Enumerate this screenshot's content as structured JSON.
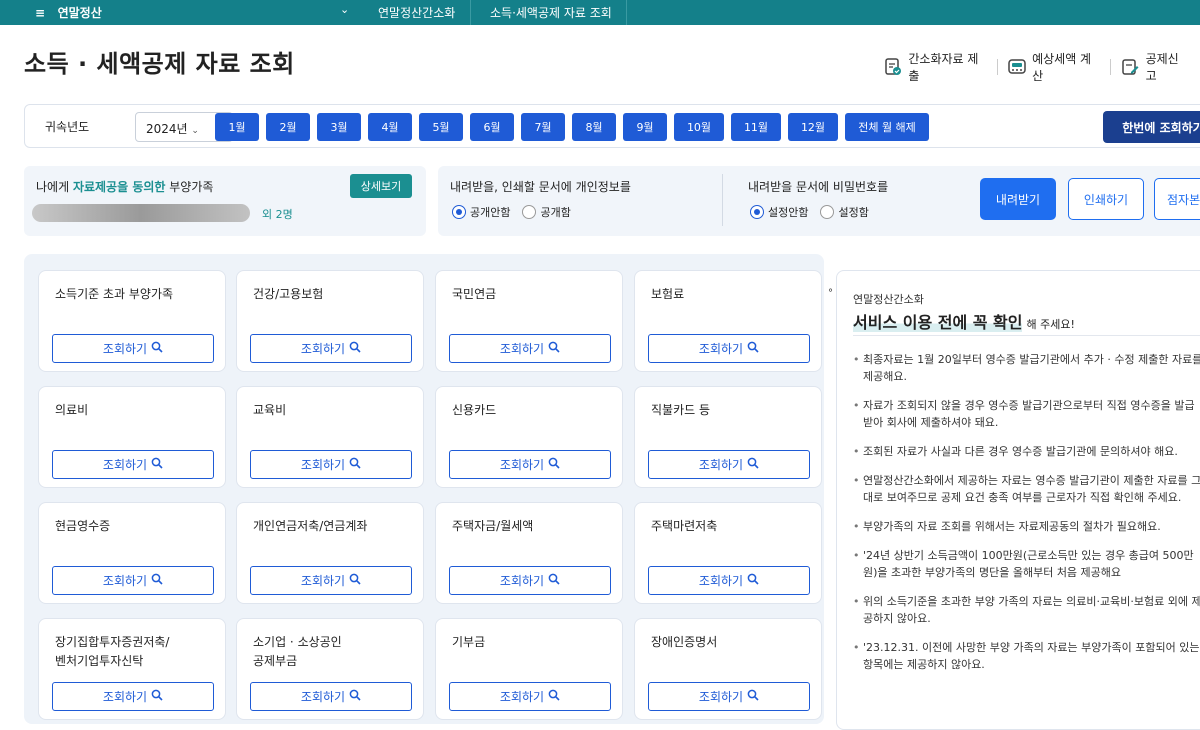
{
  "topbar": {
    "menu_label": "연말정산",
    "breadcrumb": [
      "연말정산간소화",
      "소득·세액공제 자료 조회"
    ]
  },
  "page_title": "소득 · 세액공제 자료 조회",
  "actions": [
    {
      "label": "간소화자료 제출",
      "icon": "document-submit-icon"
    },
    {
      "label": "예상세액 계산",
      "icon": "calculator-icon"
    },
    {
      "label": "공제신고",
      "icon": "form-edit-icon"
    }
  ],
  "year_filter": {
    "label": "귀속년도",
    "selected_year": "2024년",
    "months": [
      "1월",
      "2월",
      "3월",
      "4월",
      "5월",
      "6월",
      "7월",
      "8월",
      "9월",
      "10월",
      "11월",
      "12월"
    ],
    "clear_all_label": "전체 월 해제",
    "query_all_label": "한번에 조회하기"
  },
  "dependents": {
    "prefix": "나에게 ",
    "highlight": "자료제공을 동의한",
    "suffix": " 부양가족",
    "detail_button": "상세보기",
    "others_count": "외 2명"
  },
  "download_options": {
    "personal_info_question": "내려받을, 인쇄할 문서에 개인정보를",
    "personal_info_options": [
      {
        "label": "공개안함",
        "selected": true
      },
      {
        "label": "공개함",
        "selected": false
      }
    ],
    "password_question": "내려받을 문서에 비밀번호를",
    "password_options": [
      {
        "label": "설정안함",
        "selected": true
      },
      {
        "label": "설정함",
        "selected": false
      }
    ],
    "download_button": "내려받기",
    "print_button": "인쇄하기",
    "braille_button": "점자본"
  },
  "query_button_label": "조회하기",
  "categories": [
    "소득기준 초과 부양가족",
    "건강/고용보험",
    "국민연금",
    "보험료",
    "의료비",
    "교육비",
    "신용카드",
    "직불카드 등",
    "현금영수증",
    "개인연금저축/연금계좌",
    "주택자금/월세액",
    "주택마련저축",
    "장기집합투자증권저축/\n벤처기업투자신탁",
    "소기업 · 소상공인\n공제부금",
    "기부금",
    "장애인증명서"
  ],
  "notice": {
    "subtitle": "연말정산간소화",
    "headline": "서비스 이용 전에 꼭 확인",
    "headline_rest": "해 주세요!",
    "items": [
      "최종자료는 1월 20일부터 영수증 발급기관에서 추가 · 수정 제출한 자료를 제공해요.",
      "자료가 조회되지 않을 경우 영수증 발급기관으로부터 직접 영수증을 발급받아 회사에 제출하셔야 돼요.",
      "조회된 자료가 사실과 다른 경우 영수증 발급기관에 문의하셔야 해요.",
      "연말정산간소화에서 제공하는 자료는 영수증 발급기관이 제출한 자료를 그대로 보여주므로 공제 요건 충족 여부를 근로자가 직접 확인해 주세요.",
      "부양가족의 자료 조회를 위해서는 자료제공동의 절차가 필요해요.",
      "'24년 상반기 소득금액이 100만원(근로소득만 있는 경우 총급여 500만원)을 초과한 부양가족의 명단을 올해부터 처음 제공해요",
      "위의 소득기준을 초과한 부양 가족의 자료는 의료비·교육비·보험료 외에 제공하지 않아요.",
      "'23.12.31. 이전에 사망한 부양 가족의 자료는 부양가족이 포함되어 있는 항목에는 제공하지 않아요."
    ]
  },
  "colors": {
    "topbar": "#14808a",
    "primary_blue": "#1f5bd6",
    "teal": "#1b8f91",
    "navy": "#1b3f8f"
  }
}
